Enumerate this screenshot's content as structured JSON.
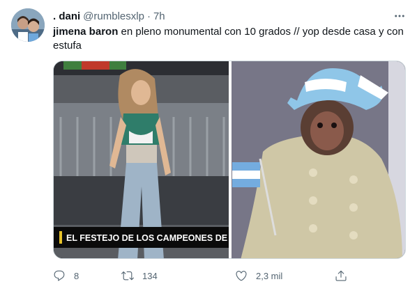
{
  "tweet": {
    "display_name": ". dani",
    "handle": "@rumblesxlp",
    "separator": "·",
    "time": "7h",
    "text_bold": "jimena baron",
    "text_rest": " en pleno monumental con 10 grados // yop desde casa y con estufa",
    "media_caption": "EL FESTEJO DE LOS CAMPEONES DE A",
    "reply_count": "8",
    "retweet_count": "134",
    "like_count": "2,3 mil"
  },
  "icons": {
    "more": "more-horizontal-icon",
    "reply": "reply-icon",
    "retweet": "retweet-icon",
    "like": "heart-icon",
    "share": "share-icon"
  },
  "colors": {
    "text_primary": "#0f1419",
    "text_secondary": "#536471",
    "border": "#cfd9de"
  }
}
